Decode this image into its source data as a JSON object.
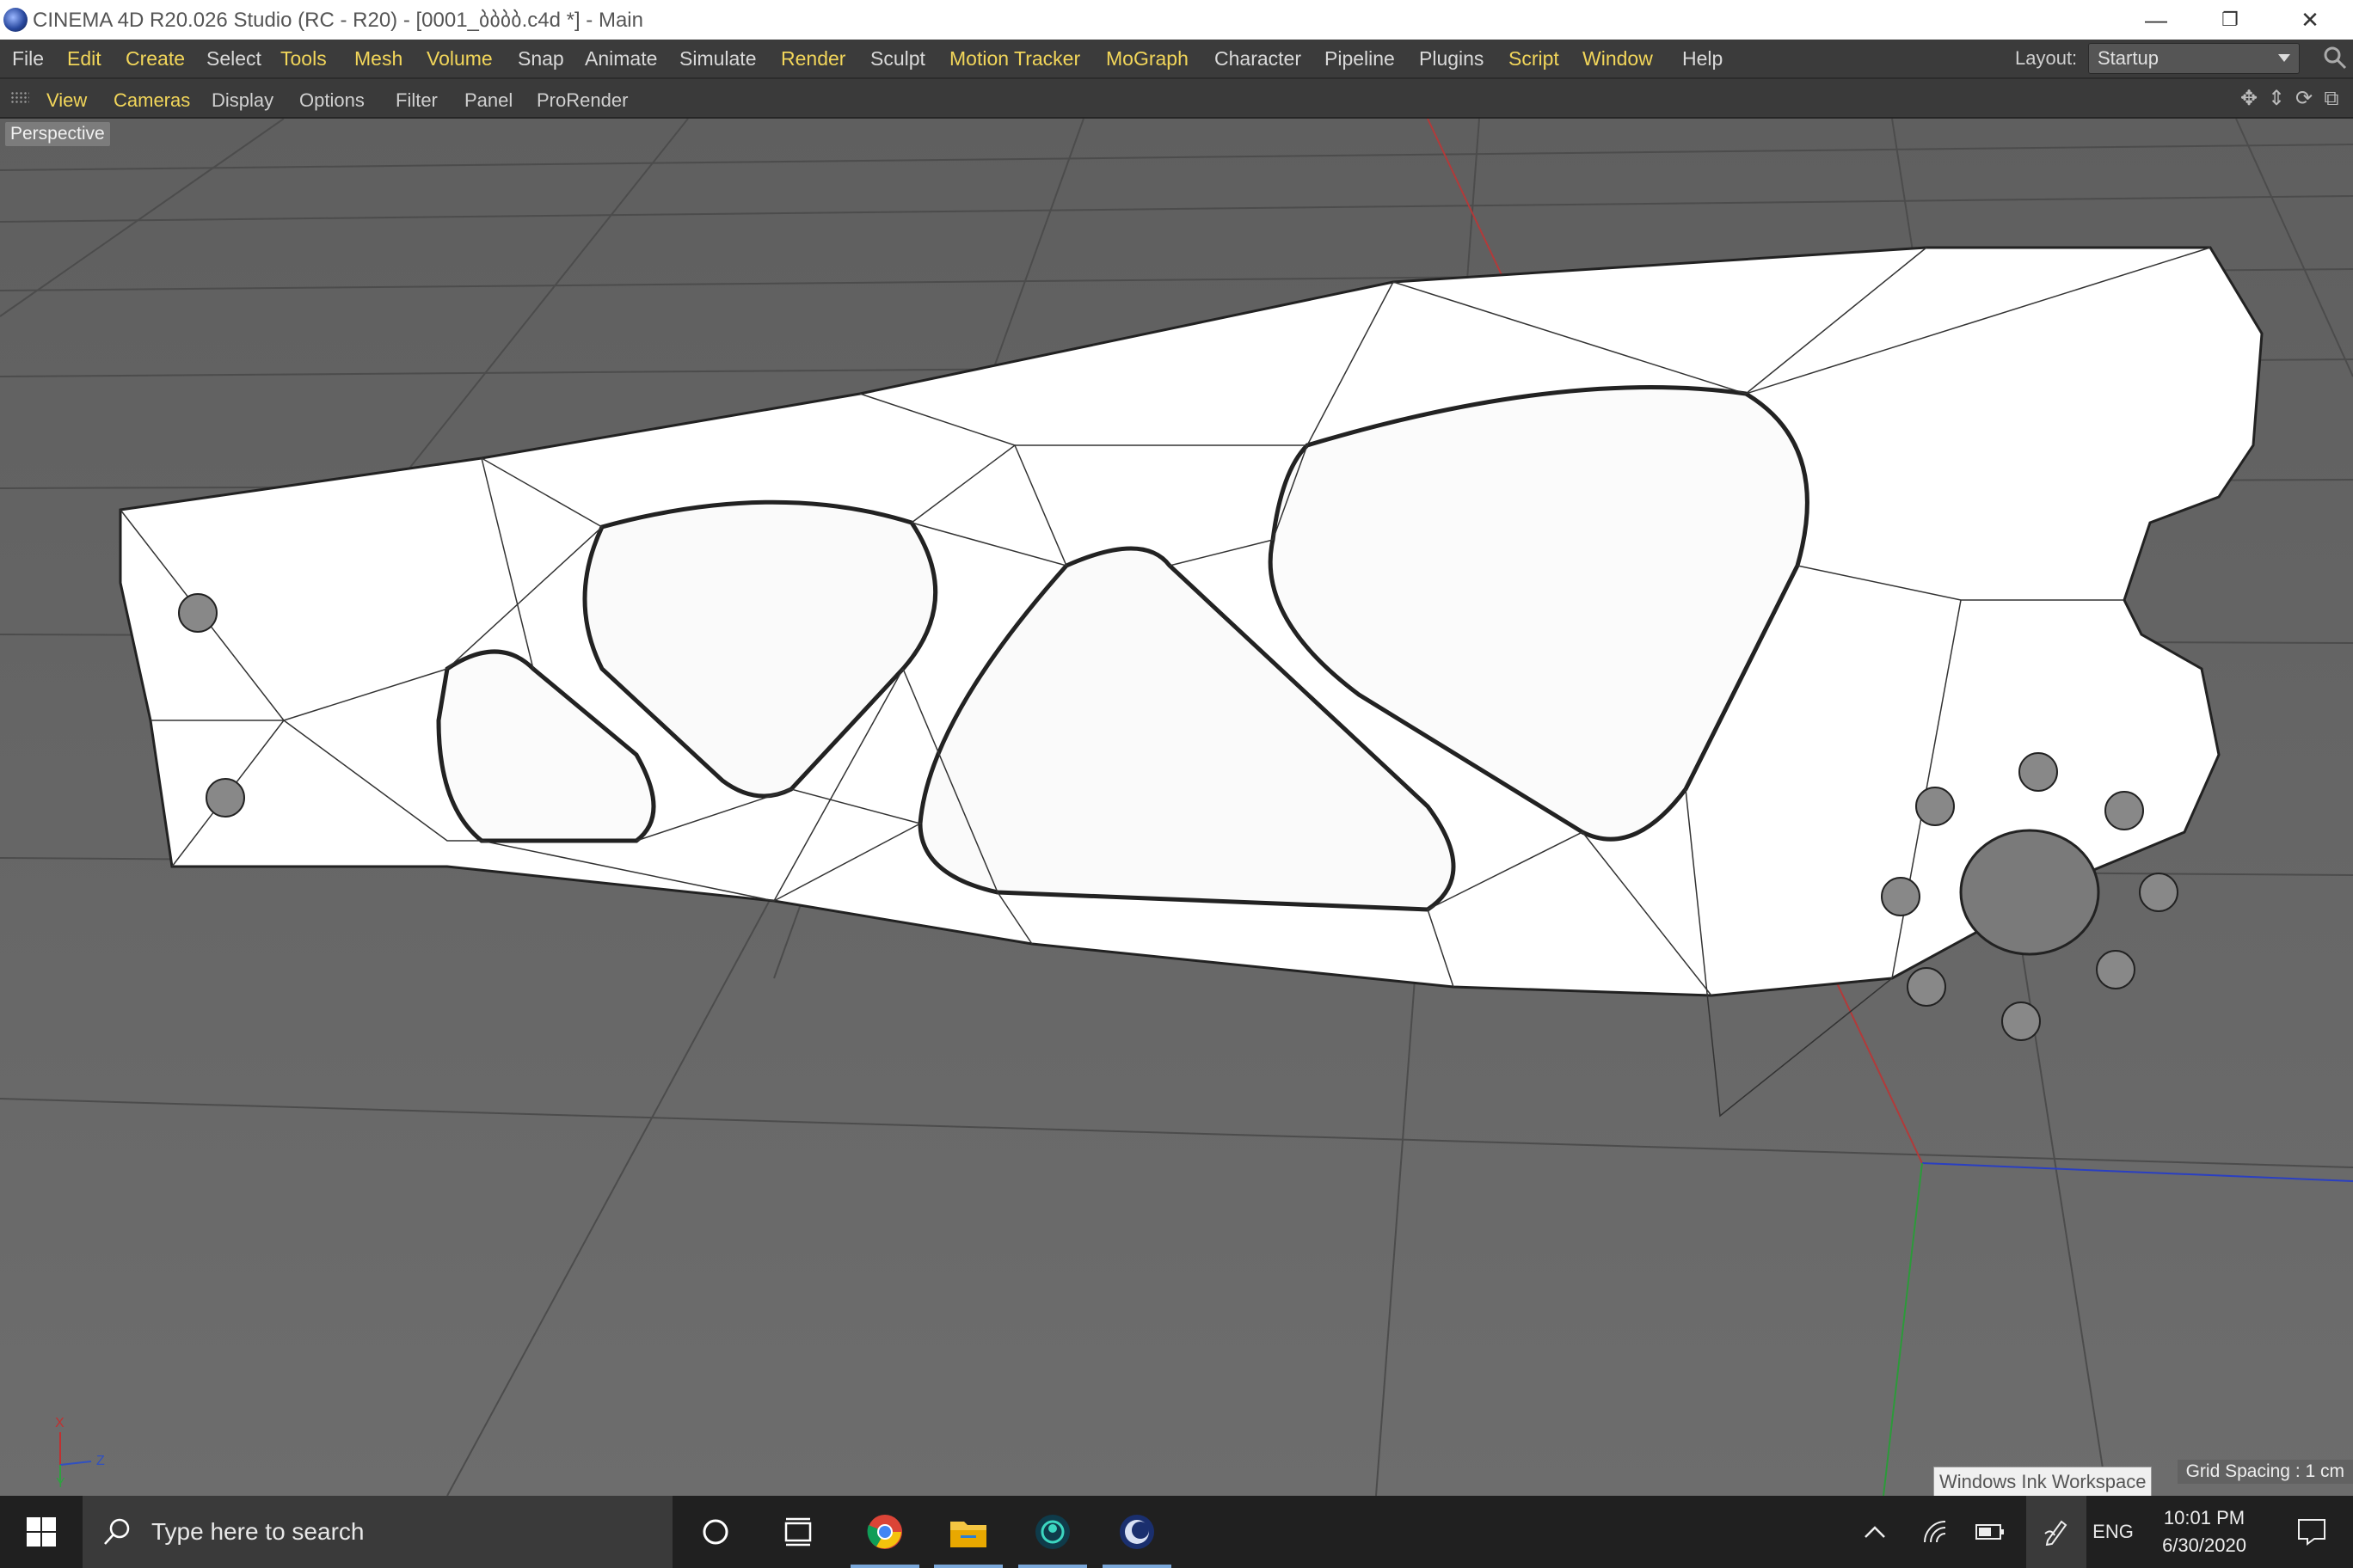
{
  "window": {
    "title": "CINEMA 4D R20.026 Studio (RC - R20) - [0001_ბბბბ.c4d *] - Main",
    "controls": [
      "minimize",
      "restore",
      "close"
    ]
  },
  "menubar": {
    "items": [
      {
        "label": "File",
        "highlight": false
      },
      {
        "label": "Edit",
        "highlight": true
      },
      {
        "label": "Create",
        "highlight": true
      },
      {
        "label": "Select",
        "highlight": false
      },
      {
        "label": "Tools",
        "highlight": true
      },
      {
        "label": "Mesh",
        "highlight": true
      },
      {
        "label": "Volume",
        "highlight": true
      },
      {
        "label": "Snap",
        "highlight": false
      },
      {
        "label": "Animate",
        "highlight": false
      },
      {
        "label": "Simulate",
        "highlight": false
      },
      {
        "label": "Render",
        "highlight": true
      },
      {
        "label": "Sculpt",
        "highlight": false
      },
      {
        "label": "Motion Tracker",
        "highlight": true
      },
      {
        "label": "MoGraph",
        "highlight": true
      },
      {
        "label": "Character",
        "highlight": false
      },
      {
        "label": "Pipeline",
        "highlight": false
      },
      {
        "label": "Plugins",
        "highlight": false
      },
      {
        "label": "Script",
        "highlight": true
      },
      {
        "label": "Window",
        "highlight": true
      },
      {
        "label": "Help",
        "highlight": false
      }
    ],
    "layout_label": "Layout:",
    "layout_value": "Startup"
  },
  "viewbar": {
    "items": [
      {
        "label": "View",
        "highlight": true
      },
      {
        "label": "Cameras",
        "highlight": true
      },
      {
        "label": "Display",
        "highlight": false
      },
      {
        "label": "Options",
        "highlight": false
      },
      {
        "label": "Filter",
        "highlight": false
      },
      {
        "label": "Panel",
        "highlight": false
      },
      {
        "label": "ProRender",
        "highlight": false
      }
    ],
    "nav_icons": [
      "move-view-icon",
      "zoom-view-icon",
      "rotate-view-icon",
      "toggle-panel-icon"
    ]
  },
  "viewport": {
    "camera_label": "Perspective",
    "grid_spacing": "Grid Spacing : 1 cm",
    "axis_labels": {
      "x": "X",
      "y": "Y",
      "z": "Z"
    }
  },
  "tooltip": {
    "ink": "Windows Ink Workspace"
  },
  "taskbar": {
    "search_placeholder": "Type here to search",
    "apps": [
      "cortana-icon",
      "task-view-icon",
      "chrome-icon",
      "file-explorer-icon",
      "app-icon",
      "cinema4d-icon"
    ],
    "tray": {
      "lang": "ENG",
      "time": "10:01 PM",
      "date": "6/30/2020"
    }
  },
  "colors": {
    "accent_menu": "#f2d65a",
    "viewport_bg": "#6a6a6a",
    "axis_x": "#c0392b",
    "axis_y": "#2ecc40",
    "axis_z": "#2244cc"
  }
}
